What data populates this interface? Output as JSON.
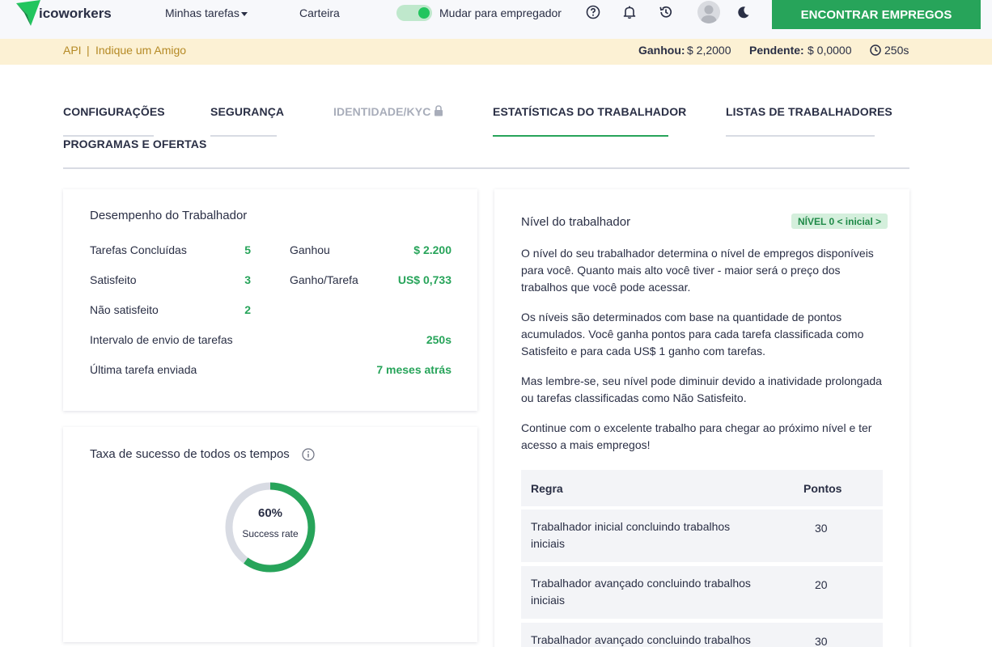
{
  "topnav": {
    "logo_text": "icoworkers",
    "tasks_label": "Minhas tarefas",
    "wallet_label": "Carteira",
    "switch_label": "Mudar para empregador",
    "switch_on": true,
    "cta_label": "ENCONTRAR EMPREGOS",
    "icons": [
      "help-circle-icon",
      "bell-icon",
      "history-icon",
      "avatar",
      "moon-icon"
    ]
  },
  "infobar": {
    "api_label": "API",
    "separator": "|",
    "refer_label": "Indique um Amigo",
    "earned_label": "Ganhou:",
    "earned_value": "$ 2,2000",
    "pending_label": "Pendente:",
    "pending_value": "$ 0,0000",
    "timer_value": "250s"
  },
  "tabs": [
    {
      "label": "Configurações"
    },
    {
      "label": "Segurança"
    },
    {
      "label": "Identidade/KYC"
    },
    {
      "label": "Estatísticas do trabalhador"
    },
    {
      "label": "Listas de trabalhadores"
    },
    {
      "label": "Programas e ofertas"
    }
  ],
  "performance": {
    "title": "Desempenho do Trabalhador",
    "completed_label": "Tarefas Concluídas",
    "completed_value": "5",
    "satisfied_label": "Satisfeito",
    "satisfied_value": "3",
    "unsatisfied_label": "Não satisfeito",
    "unsatisfied_value": "2",
    "earned_label": "Ganhou",
    "earned_value": "$ 2.200",
    "per_task_label": "Ganho/Tarefa",
    "per_task_value": "US$ 0,733",
    "interval_label": "Intervalo de envio de tarefas",
    "interval_value": "250s",
    "last_label": "Última tarefa enviada",
    "last_value": "7 meses atrás"
  },
  "success": {
    "title": "Taxa de sucesso de todos os tempos",
    "percent_text": "60%",
    "percent_value": 0.6,
    "sub_label": "Success rate",
    "color_fill": "#27a45a",
    "color_track": "#d8dbe3"
  },
  "level": {
    "title": "Nível do trabalhador",
    "badge": "NÍVEL 0 < inicial >",
    "p1": "O nível do seu trabalhador determina o nível de empregos disponíveis para você. Quanto mais alto você tiver - maior será o preço dos trabalhos que você pode acessar.",
    "p2": "Os níveis são determinados com base na quantidade de pontos acumulados. Você ganha pontos para cada tarefa classificada como Satisfeito e para cada US$ 1 ganho com tarefas.",
    "p3": "Mas lembre-se, seu nível pode diminuir devido a inatividade prolongada ou tarefas classificadas como Não Satisfeito.",
    "p4": "Continue com o excelente trabalho para chegar ao próximo nível e ter acesso a mais empregos!",
    "table_headers": [
      "Regra",
      "Pontos"
    ],
    "rows": [
      {
        "rule": "Trabalhador inicial concluindo trabalhos iniciais",
        "points": "30"
      },
      {
        "rule": "Trabalhador avançado concluindo trabalhos iniciais",
        "points": "20"
      },
      {
        "rule": "Trabalhador avançado concluindo trabalhos",
        "points": "30"
      }
    ]
  },
  "colors": {
    "accent": "#27a45a",
    "infobar_bg": "#fcf1d4",
    "infobar_link": "#b58a25"
  }
}
